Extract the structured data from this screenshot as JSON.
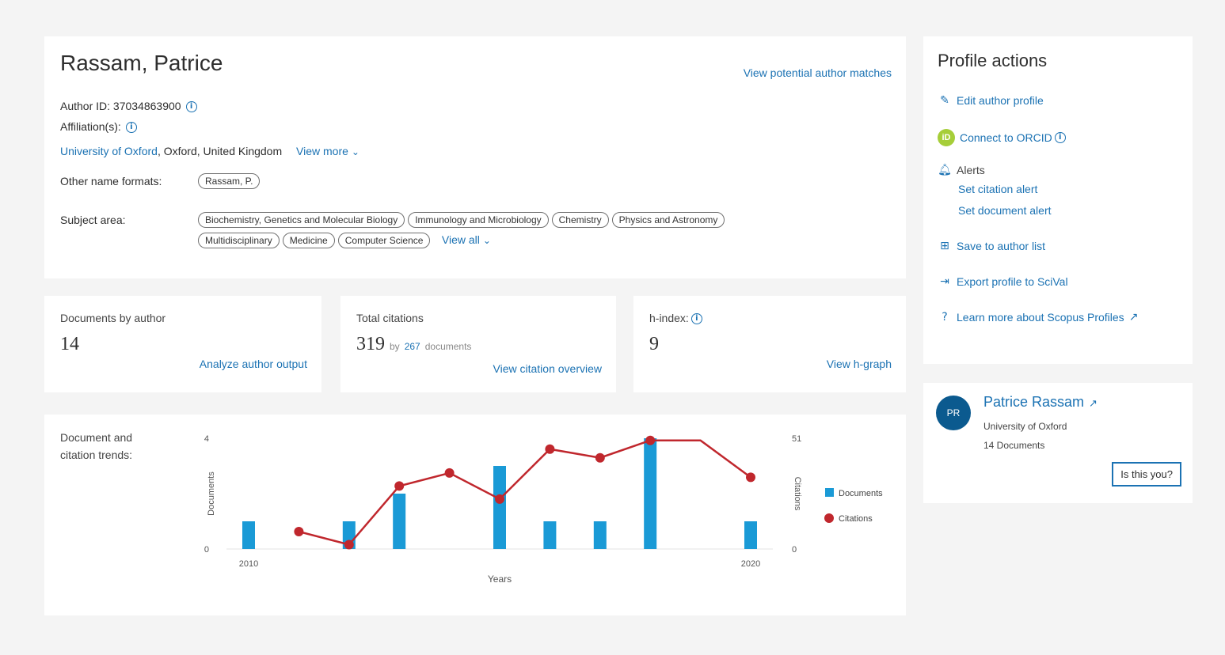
{
  "profile": {
    "name": "Rassam, Patrice",
    "potential_matches_link": "View potential author matches",
    "author_id_label": "Author ID: 37034863900",
    "affiliations_label": "Affiliation(s):",
    "affiliation_link": "University of Oxford",
    "affiliation_rest": ", Oxford, United Kingdom",
    "view_more": "View more",
    "other_names_label": "Other name formats:",
    "other_names": [
      "Rassam, P."
    ],
    "subject_area_label": "Subject area:",
    "subject_areas": [
      "Biochemistry, Genetics and Molecular Biology",
      "Immunology and Microbiology",
      "Chemistry",
      "Physics and Astronomy",
      "Multidisciplinary",
      "Medicine",
      "Computer Science"
    ],
    "view_all": "View all"
  },
  "metrics": [
    {
      "label": "Documents by author",
      "value": "14",
      "link": "Analyze author output"
    },
    {
      "label": "Total citations",
      "value": "319",
      "sub_by": "by",
      "sub_count": "267",
      "sub_docs": "documents",
      "link": "View citation overview"
    },
    {
      "label": "h-index:",
      "value": "9",
      "link": "View h-graph"
    }
  ],
  "actions": {
    "title": "Profile actions",
    "edit": "Edit author profile",
    "orcid": "Connect to ORCID",
    "alerts": "Alerts",
    "citation_alert": "Set citation alert",
    "document_alert": "Set document alert",
    "save": "Save to author list",
    "export": "Export profile to SciVal",
    "learn": "Learn more about Scopus Profiles"
  },
  "author_card": {
    "initials": "PR",
    "name": "Patrice Rassam",
    "affiliation": "University of Oxford",
    "documents": "14 Documents",
    "button": "Is this you?"
  },
  "chart_data": {
    "type": "bar+line",
    "title": "Document and citation trends:",
    "xlabel": "Years",
    "ylabel_left": "Documents",
    "ylabel_right": "Citations",
    "left_ticks": [
      "4",
      "0"
    ],
    "right_ticks": [
      "51",
      "0"
    ],
    "xtick_labels": [
      "2010",
      "2020"
    ],
    "years": [
      2010,
      2011,
      2012,
      2013,
      2014,
      2015,
      2016,
      2017,
      2018,
      2019,
      2020
    ],
    "ylim_documents": [
      0,
      4
    ],
    "ylim_citations": [
      0,
      51
    ],
    "series": [
      {
        "name": "Documents",
        "type": "bar",
        "color": "#1a9ad6",
        "values": [
          1,
          0,
          1,
          2,
          0,
          3,
          1,
          1,
          4,
          0,
          1
        ]
      },
      {
        "name": "Citations",
        "type": "line",
        "color": "#c0272d",
        "values": [
          null,
          8,
          2,
          29,
          35,
          23,
          46,
          42,
          50,
          50,
          33
        ]
      }
    ],
    "legend": "right"
  }
}
